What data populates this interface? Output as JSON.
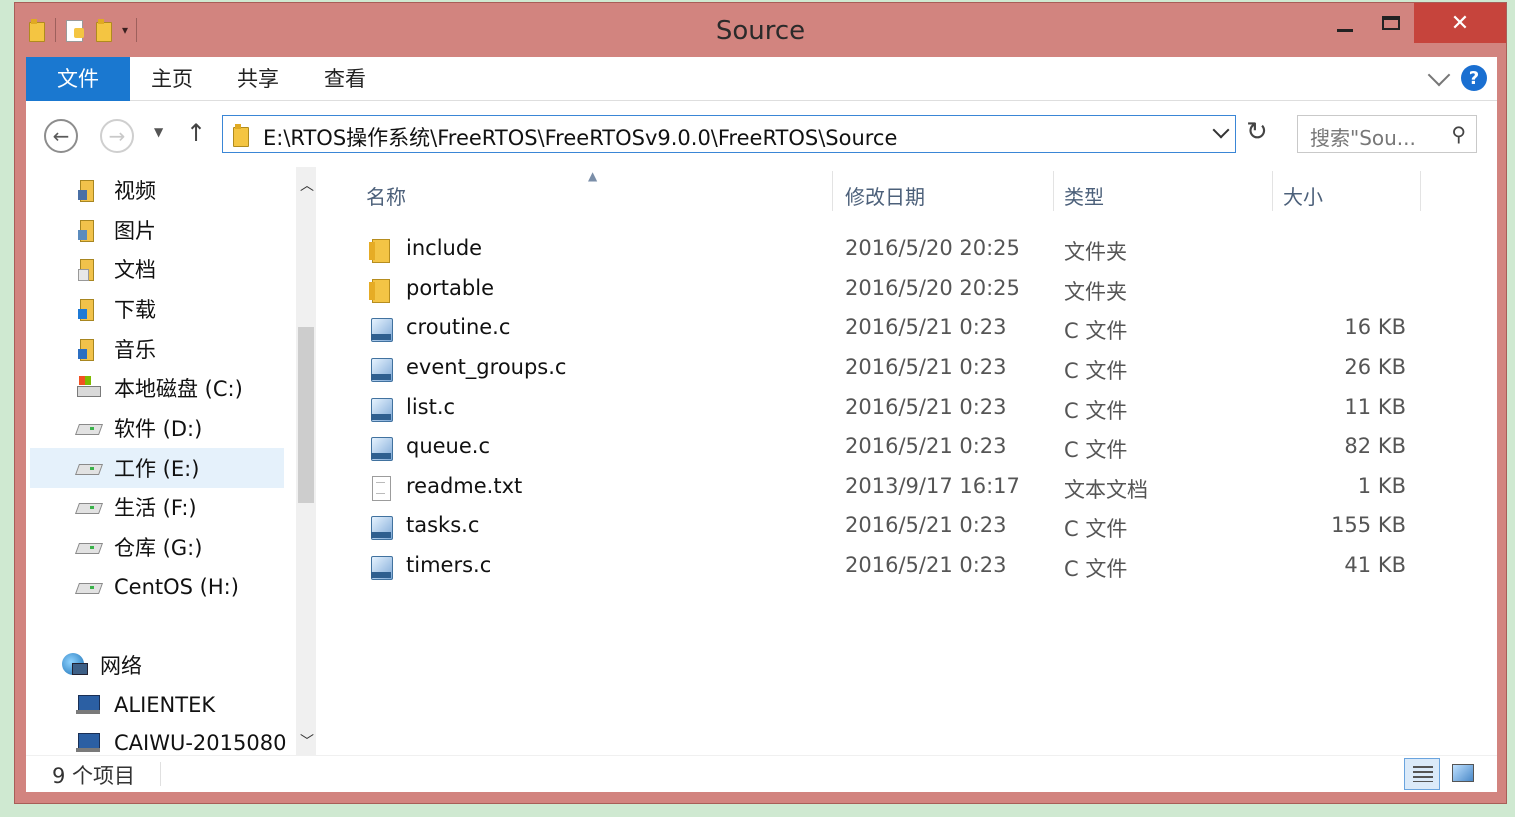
{
  "window": {
    "title": "Source"
  },
  "ribbon": {
    "tabs": [
      "文件",
      "主页",
      "共享",
      "查看"
    ]
  },
  "address": {
    "path": "E:\\RTOS操作系统\\FreeRTOS\\FreeRTOSv9.0.0\\FreeRTOS\\Source",
    "search_placeholder": "搜索\"Sou..."
  },
  "nav": {
    "items": [
      {
        "label": "视频",
        "icon": "video-library-icon"
      },
      {
        "label": "图片",
        "icon": "pictures-library-icon"
      },
      {
        "label": "文档",
        "icon": "documents-library-icon"
      },
      {
        "label": "下载",
        "icon": "downloads-library-icon"
      },
      {
        "label": "音乐",
        "icon": "music-library-icon"
      },
      {
        "label": "本地磁盘 (C:)",
        "icon": "system-drive-icon"
      },
      {
        "label": "软件 (D:)",
        "icon": "drive-icon"
      },
      {
        "label": "工作 (E:)",
        "icon": "drive-icon",
        "selected": true
      },
      {
        "label": "生活 (F:)",
        "icon": "drive-icon"
      },
      {
        "label": "仓库 (G:)",
        "icon": "drive-icon"
      },
      {
        "label": "CentOS (H:)",
        "icon": "drive-icon"
      },
      {
        "label": "网络",
        "icon": "network-icon"
      },
      {
        "label": "ALIENTEK",
        "icon": "computer-icon"
      },
      {
        "label": "CAIWU-2015080",
        "icon": "computer-icon"
      }
    ]
  },
  "columns": {
    "name": "名称",
    "date": "修改日期",
    "type": "类型",
    "size": "大小"
  },
  "files": [
    {
      "name": "include",
      "date": "2016/5/20 20:25",
      "type": "文件夹",
      "size": "",
      "icon": "folder-icon"
    },
    {
      "name": "portable",
      "date": "2016/5/20 20:25",
      "type": "文件夹",
      "size": "",
      "icon": "folder-icon"
    },
    {
      "name": "croutine.c",
      "date": "2016/5/21 0:23",
      "type": "C 文件",
      "size": "16 KB",
      "icon": "c-file-icon"
    },
    {
      "name": "event_groups.c",
      "date": "2016/5/21 0:23",
      "type": "C 文件",
      "size": "26 KB",
      "icon": "c-file-icon"
    },
    {
      "name": "list.c",
      "date": "2016/5/21 0:23",
      "type": "C 文件",
      "size": "11 KB",
      "icon": "c-file-icon"
    },
    {
      "name": "queue.c",
      "date": "2016/5/21 0:23",
      "type": "C 文件",
      "size": "82 KB",
      "icon": "c-file-icon"
    },
    {
      "name": "readme.txt",
      "date": "2013/9/17 16:17",
      "type": "文本文档",
      "size": "1 KB",
      "icon": "text-file-icon"
    },
    {
      "name": "tasks.c",
      "date": "2016/5/21 0:23",
      "type": "C 文件",
      "size": "155 KB",
      "icon": "c-file-icon"
    },
    {
      "name": "timers.c",
      "date": "2016/5/21 0:23",
      "type": "C 文件",
      "size": "41 KB",
      "icon": "c-file-icon"
    }
  ],
  "status": {
    "count": "9 个项目"
  },
  "colors": {
    "titlebar": "#d2847f",
    "close": "#c6443c",
    "file_tab": "#1a78d0",
    "header_text": "#4c607a"
  }
}
